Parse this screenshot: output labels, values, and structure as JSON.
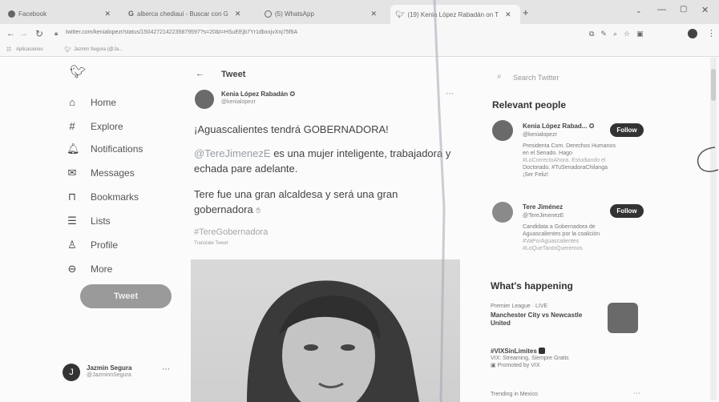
{
  "browser": {
    "tabs": [
      {
        "label": "Facebook"
      },
      {
        "label": "alberca chediaui - Buscar con G"
      },
      {
        "label": "(5) WhatsApp"
      },
      {
        "label": "(19) Kenia López Rabadán on T"
      }
    ],
    "url": "twitter.com/kenialopezr/status/1504272142235879597?s=20&t=HSuEEjb7Yr1dbxxjvXnj75f6A",
    "bookmarks": [
      "Aplicaciones",
      "Jazmin Segura (@Ja..."
    ]
  },
  "sidebar": {
    "items": [
      {
        "label": "Home",
        "icon": "home-icon"
      },
      {
        "label": "Explore",
        "icon": "hashtag-icon"
      },
      {
        "label": "Notifications",
        "icon": "bell-icon"
      },
      {
        "label": "Messages",
        "icon": "envelope-icon"
      },
      {
        "label": "Bookmarks",
        "icon": "bookmark-icon"
      },
      {
        "label": "Lists",
        "icon": "list-icon"
      },
      {
        "label": "Profile",
        "icon": "person-icon"
      },
      {
        "label": "More",
        "icon": "more-icon"
      }
    ],
    "tweet_button": "Tweet",
    "account": {
      "name": "Jazmin Segura",
      "handle": "@JazminnSegura",
      "initial": "J"
    }
  },
  "main": {
    "header": "Tweet",
    "author": {
      "name": "Kenia López Rabadán",
      "handle": "@kenialopezr"
    },
    "line1": "¡Aguascalientes tendrá GOBERNADORA!",
    "mention": "@TereJimenezE",
    "line2_rest": " es una mujer inteligente, trabajadora y",
    "line3": "echada pare adelante.",
    "line4": "Tere fue una gran alcaldesa y será una gran",
    "line5": "gobernadora",
    "hashtag": "#TereGobernadora",
    "translate": "Translate Tweet"
  },
  "right": {
    "search_placeholder": "Search Twitter",
    "relevant_title": "Relevant people",
    "people": [
      {
        "name": "Kenia López Rabad...",
        "handle": "@kenialopezr",
        "bio": [
          "Presidenta Com. Derechos Humanos",
          "en el Senado. Hago",
          "#LoCorrectoAhora. Estudiando el",
          "Doctorado. #TuSenadoraChilanga",
          "¡Ser Feliz!"
        ],
        "follow": "Follow"
      },
      {
        "name": "Tere Jiménez",
        "handle": "@TereJimenezE",
        "bio": [
          "Candidata a Gobernadora de",
          "Aguascalientes por la coalición",
          "#VaPorAguascalientes",
          "#LoQueTantoQueremos"
        ],
        "follow": "Follow"
      }
    ],
    "happening_title": "What's happening",
    "trends": [
      {
        "meta": "Premier League · LIVE",
        "title": "Manchester City vs Newcastle United"
      },
      {
        "title": "#VIXSinLimites",
        "desc": "VIX: Streaming, Siempre Gratis",
        "promo": "Promoted by VIX"
      }
    ],
    "trending_footer": "Trending in Mexico"
  }
}
